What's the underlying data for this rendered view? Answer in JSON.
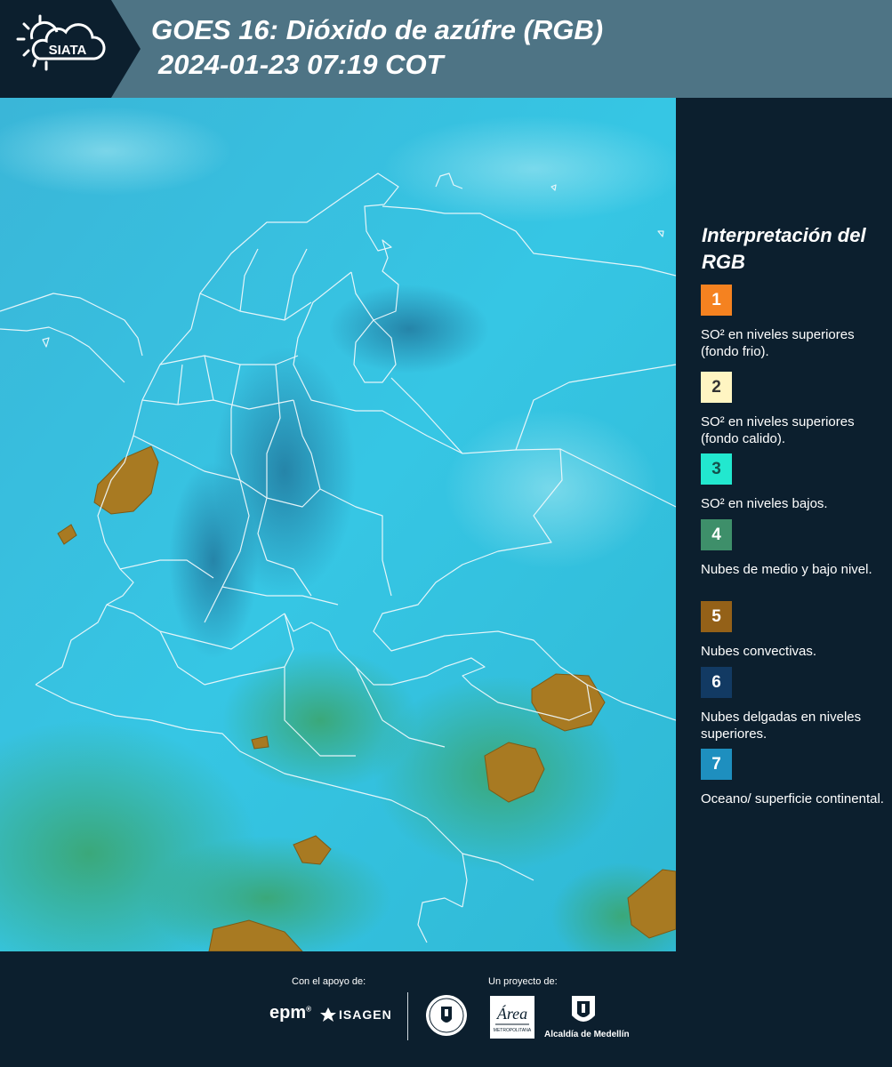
{
  "header": {
    "logo_text": "SIATA",
    "title_line1": "GOES 16: Dióxido de azúfre (RGB)",
    "title_line2": "2024-01-23 07:19 COT"
  },
  "colors": {
    "header_bg": "#4e7485",
    "panel_bg": "#0c1f2e",
    "map_base": "#2fc3df",
    "map_dark": "#2a86a6",
    "cloud_orange": "#b07a1e",
    "cloud_green": "#3aa87a"
  },
  "legend": {
    "title": "Interpretación del RGB",
    "items": [
      {
        "number": "1",
        "color": "#f58220",
        "text_color": "#ffffff",
        "text": "SO² en niveles superiores (fondo frio)."
      },
      {
        "number": "2",
        "color": "#fff5c2",
        "text_color": "#333333",
        "text": "SO² en niveles superiores (fondo calido)."
      },
      {
        "number": "3",
        "color": "#22e8cf",
        "text_color": "#14524d",
        "text": "SO² en niveles bajos."
      },
      {
        "number": "4",
        "color": "#3e8f6a",
        "text_color": "#ffffff",
        "text": "Nubes de medio y bajo nivel."
      },
      {
        "number": "5",
        "color": "#946118",
        "text_color": "#ffffff",
        "text": "Nubes convectivas."
      },
      {
        "number": "6",
        "color": "#123a63",
        "text_color": "#ffffff",
        "text": "Nubes delgadas en niveles superiores."
      },
      {
        "number": "7",
        "color": "#1e8fbf",
        "text_color": "#ffffff",
        "text": "Oceano/ superficie continental."
      }
    ]
  },
  "footer": {
    "support_label": "Con el apoyo de:",
    "project_label": "Un proyecto de:",
    "epm_logo": "epm",
    "isagen_logo": "ISAGEN",
    "area_metropolitana_logo": "Área Metropolitana Valle de Aburrá",
    "medellin_seal_logo": "Medellín",
    "alcaldia_label": "Alcaldía de Medellín"
  }
}
